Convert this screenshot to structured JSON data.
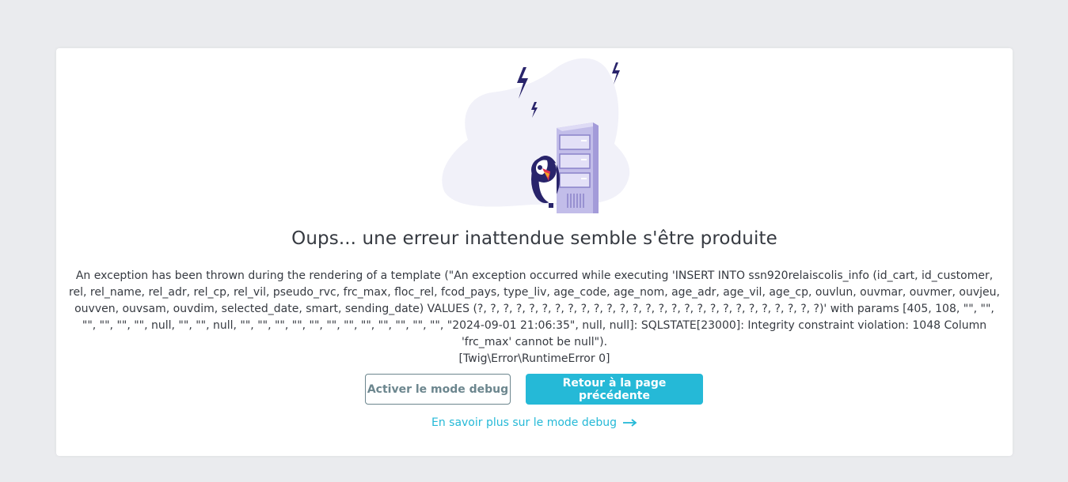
{
  "error_page": {
    "title": "Oups... une erreur inattendue semble s'être produite",
    "message": "An exception has been thrown during the rendering of a template (\"An exception occurred while executing 'INSERT INTO ssn920relaiscolis_info (id_cart, id_customer, rel, rel_name, rel_adr, rel_cp, rel_vil, pseudo_rvc, frc_max, floc_rel, fcod_pays, type_liv, age_code, age_nom, age_adr, age_vil, age_cp, ouvlun, ouvmar, ouvmer, ouvjeu, ouvven, ouvsam, ouvdim, selected_date, smart, sending_date) VALUES (?, ?, ?, ?, ?, ?, ?, ?, ?, ?, ?, ?, ?, ?, ?, ?, ?, ?, ?, ?, ?, ?, ?, ?, ?, ?, ?)' with params [405, 108, \"\", \"\", \"\", \"\", \"\", \"\", null, \"\", \"\", null, \"\", \"\", \"\", \"\", \"\", \"\", \"\", \"\", \"\", \"\", \"\", \"\", \"2024-09-01 21:06:35\", null, null]: SQLSTATE[23000]: Integrity constraint violation: 1048 Column 'frc_max' cannot be null\").",
    "error_code": "[Twig\\Error\\RuntimeError 0]",
    "debug_button_label": "Activer le mode debug",
    "back_button_label": "Retour à la page précédente",
    "learn_more_label": "En savoir plus sur le mode debug"
  },
  "colors": {
    "page_background": "#eaebee",
    "accent": "#25b9d7",
    "secondary_border": "#6c868e",
    "text": "#363a41"
  },
  "icons": {
    "illustration": "server-error-illustration",
    "arrow": "arrow-right-icon"
  }
}
